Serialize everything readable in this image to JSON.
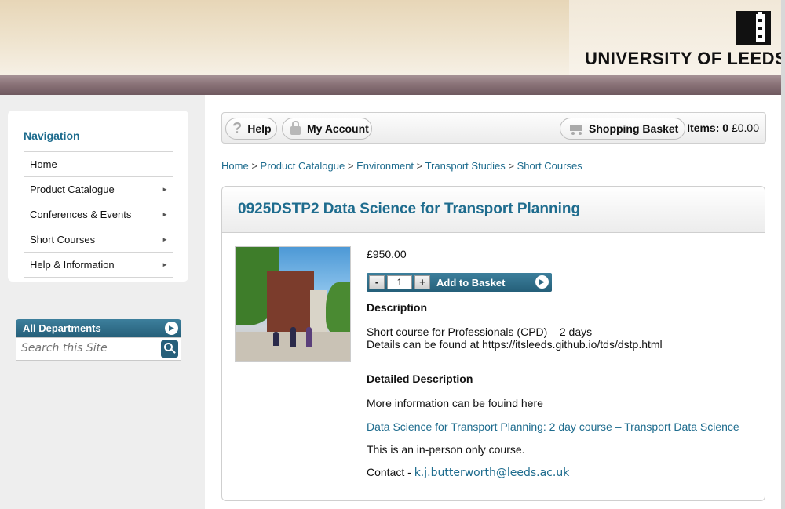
{
  "header": {
    "logo_text": "UNIVERSITY OF LEEDS"
  },
  "sidebar": {
    "nav_title": "Navigation",
    "items": [
      {
        "label": "Home",
        "has_arrow": false
      },
      {
        "label": "Product Catalogue",
        "has_arrow": true
      },
      {
        "label": "Conferences & Events",
        "has_arrow": true
      },
      {
        "label": "Short Courses",
        "has_arrow": true
      },
      {
        "label": "Help & Information",
        "has_arrow": true
      }
    ],
    "departments_label": "All Departments",
    "search_placeholder": "Search this Site"
  },
  "toolbar": {
    "help_label": "Help",
    "account_label": "My Account",
    "basket_label": "Shopping Basket",
    "items_label": "Items:",
    "items_count": "0",
    "items_total": "£0.00"
  },
  "breadcrumb": [
    "Home",
    "Product Catalogue",
    "Environment",
    "Transport Studies",
    "Short Courses"
  ],
  "product": {
    "title": "0925DSTP2 Data Science for Transport Planning",
    "price": "£950.00",
    "quantity": "1",
    "minus_label": "-",
    "plus_label": "+",
    "add_label": "Add to Basket",
    "description_heading": "Description",
    "description_line1": "Short course for Professionals (CPD) – 2 days",
    "description_line2": "Details can be found at https://itsleeds.github.io/tds/dstp.html",
    "detailed_heading": "Detailed Description",
    "more_info": "More information can be fouind here",
    "course_link": "Data Science for Transport Planning: 2 day course – Transport Data Science",
    "in_person": "This is an in-person only course.",
    "contact_label": "Contact -",
    "contact_email": "k.j.butterworth@leeds.ac.uk"
  },
  "colors": {
    "accent": "#1e6c8e",
    "button": "#255f79",
    "band": "#7f686d"
  }
}
